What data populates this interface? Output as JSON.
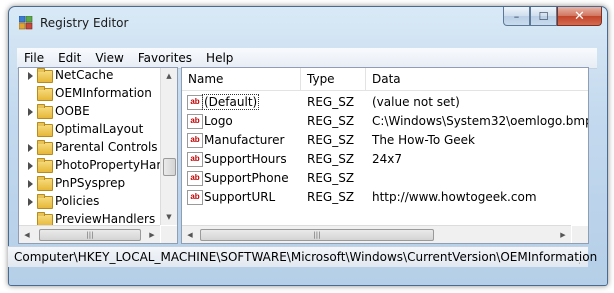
{
  "window": {
    "title": "Registry Editor",
    "caption_buttons": {
      "minimize": "–",
      "maximize": "☐",
      "close": "✕"
    }
  },
  "menu": [
    "File",
    "Edit",
    "View",
    "Favorites",
    "Help"
  ],
  "tree": {
    "items": [
      {
        "label": "NetCache"
      },
      {
        "label": "OEMInformation"
      },
      {
        "label": "OOBE"
      },
      {
        "label": "OptimalLayout"
      },
      {
        "label": "Parental Controls"
      },
      {
        "label": "PhotoPropertyHar"
      },
      {
        "label": "PnPSysprep"
      },
      {
        "label": "Policies"
      },
      {
        "label": "PreviewHandlers"
      }
    ]
  },
  "values": {
    "headers": {
      "name": "Name",
      "type": "Type",
      "data": "Data"
    },
    "rows": [
      {
        "name": "(Default)",
        "type": "REG_SZ",
        "data": "(value not set)"
      },
      {
        "name": "Logo",
        "type": "REG_SZ",
        "data": "C:\\Windows\\System32\\oemlogo.bmp"
      },
      {
        "name": "Manufacturer",
        "type": "REG_SZ",
        "data": "The How-To Geek"
      },
      {
        "name": "SupportHours",
        "type": "REG_SZ",
        "data": "24x7"
      },
      {
        "name": "SupportPhone",
        "type": "REG_SZ",
        "data": ""
      },
      {
        "name": "SupportURL",
        "type": "REG_SZ",
        "data": "http://www.howtogeek.com"
      }
    ],
    "icon_text": "ab"
  },
  "statusbar": {
    "path": "Computer\\HKEY_LOCAL_MACHINE\\SOFTWARE\\Microsoft\\Windows\\CurrentVersion\\OEMInformation"
  },
  "colors": {
    "titlebar": "#c3d9ee",
    "close_button": "#c1452b",
    "folder": "#e6b73a",
    "string_icon_text": "#c00000"
  }
}
